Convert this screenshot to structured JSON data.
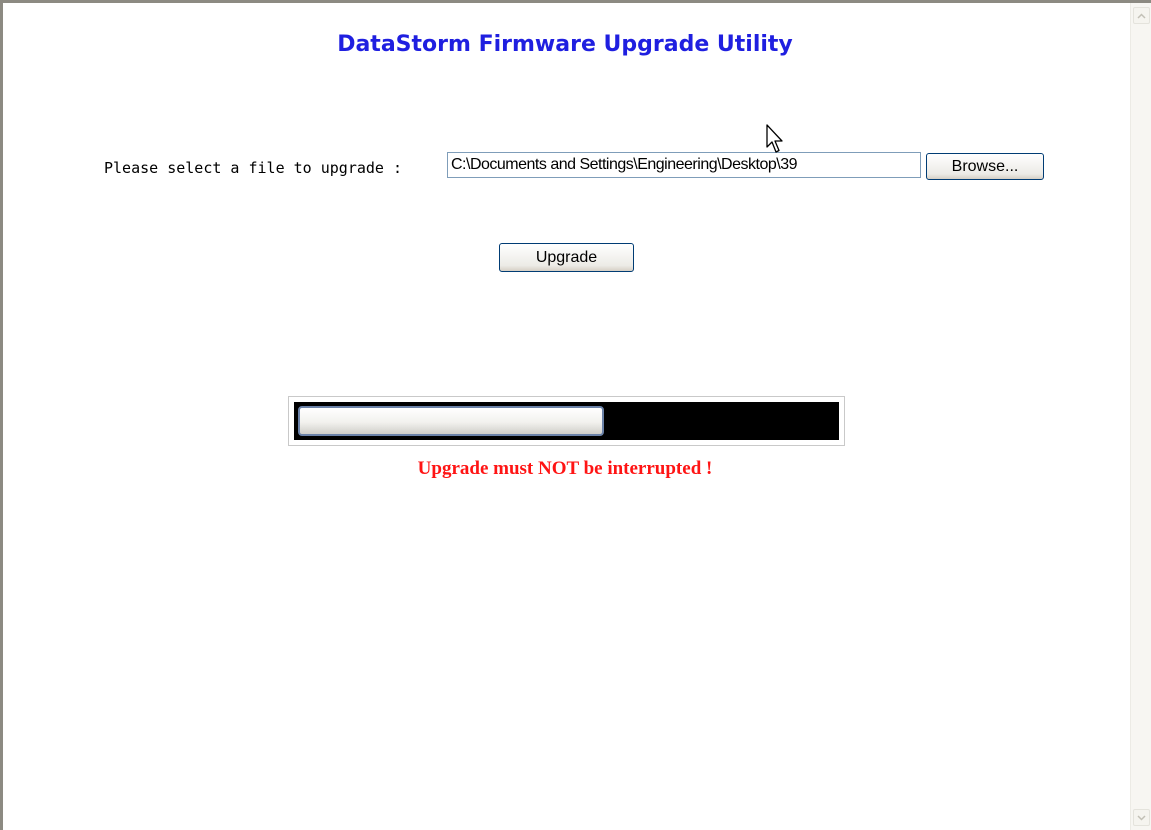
{
  "title": "DataStorm Firmware Upgrade Utility",
  "file_select": {
    "label": "Please select a file to upgrade :",
    "value": "C:\\Documents and Settings\\Engineering\\Desktop\\39",
    "browse_label": "Browse..."
  },
  "upgrade_label": "Upgrade",
  "progress": {
    "fraction": 0.57
  },
  "warning": "Upgrade must NOT be interrupted !",
  "colors": {
    "title": "#1f1fe0",
    "warning": "#ff1414",
    "progress_track": "#000000"
  },
  "icons": {
    "scroll_up": "chevron-up-icon",
    "scroll_down": "chevron-down-icon",
    "cursor": "mouse-pointer-icon"
  }
}
